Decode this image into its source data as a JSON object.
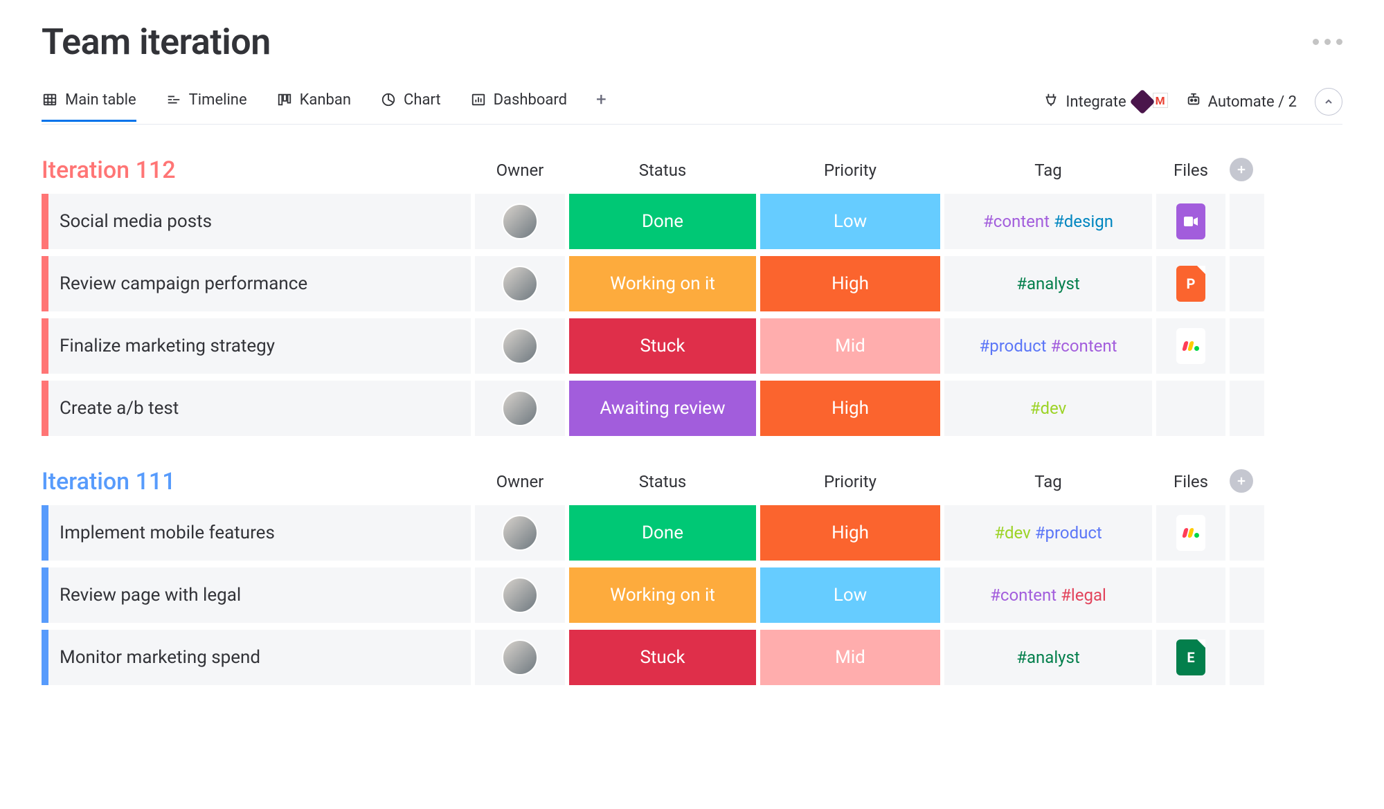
{
  "board": {
    "title": "Team iteration"
  },
  "views": {
    "tabs": [
      {
        "label": "Main table",
        "active": true,
        "icon": "table-icon"
      },
      {
        "label": "Timeline",
        "active": false,
        "icon": "timeline-icon"
      },
      {
        "label": "Kanban",
        "active": false,
        "icon": "kanban-icon"
      },
      {
        "label": "Chart",
        "active": false,
        "icon": "chart-icon"
      },
      {
        "label": "Dashboard",
        "active": false,
        "icon": "dashboard-icon"
      }
    ],
    "add_label": "+"
  },
  "actions": {
    "integrate_label": "Integrate",
    "automate_label": "Automate / 2"
  },
  "columns": {
    "owner": "Owner",
    "status": "Status",
    "priority": "Priority",
    "tag": "Tag",
    "files": "Files"
  },
  "status_colors": {
    "Done": "#00c875",
    "Working on it": "#fdab3d",
    "Stuck": "#df2f4a",
    "Awaiting review": "#a25ddc"
  },
  "priority_colors": {
    "Low": "#66ccff",
    "High": "#fb642e",
    "Mid": "#ffadad"
  },
  "tag_colors": {
    "#content": "#a25ddc",
    "#design": "#0086c0",
    "#analyst": "#037f4c",
    "#product": "#5b76f7",
    "#dev": "#9cd326",
    "#legal": "#e2445c"
  },
  "file_types": {
    "video": {
      "bg": "#a25ddc",
      "glyph": "■",
      "fold": false
    },
    "ppt": {
      "bg": "#fb642e",
      "glyph": "P",
      "fold": true
    },
    "monday": {
      "bg": "#ffffff",
      "glyph": "⁕",
      "fold": false,
      "fg": "#333"
    },
    "excel": {
      "bg": "#037f4c",
      "glyph": "E",
      "fold": true
    }
  },
  "groups": [
    {
      "title": "Iteration 112",
      "color": "#ff7575",
      "rows": [
        {
          "task": "Social media posts",
          "status": "Done",
          "priority": "Low",
          "tags": [
            "#content",
            "#design"
          ],
          "file": "video"
        },
        {
          "task": "Review campaign performance",
          "status": "Working on it",
          "priority": "High",
          "tags": [
            "#analyst"
          ],
          "file": "ppt"
        },
        {
          "task": "Finalize marketing strategy",
          "status": "Stuck",
          "priority": "Mid",
          "tags": [
            "#product",
            "#content"
          ],
          "file": "monday"
        },
        {
          "task": "Create a/b test",
          "status": "Awaiting review",
          "priority": "High",
          "tags": [
            "#dev"
          ],
          "file": null
        }
      ]
    },
    {
      "title": "Iteration 111",
      "color": "#579bfc",
      "rows": [
        {
          "task": "Implement mobile features",
          "status": "Done",
          "priority": "High",
          "tags": [
            "#dev",
            "#product"
          ],
          "file": "monday"
        },
        {
          "task": "Review page with legal",
          "status": "Working on it",
          "priority": "Low",
          "tags": [
            "#content",
            "#legal"
          ],
          "file": null
        },
        {
          "task": "Monitor marketing spend",
          "status": "Stuck",
          "priority": "Mid",
          "tags": [
            "#analyst"
          ],
          "file": "excel"
        }
      ]
    }
  ]
}
